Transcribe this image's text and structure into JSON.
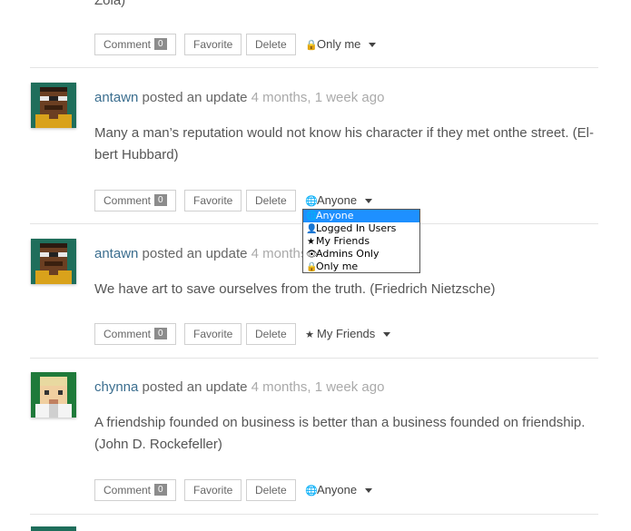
{
  "top_fragment": "Zola)",
  "buttons": {
    "comment": "Comment",
    "favorite": "Favorite",
    "delete": "Delete"
  },
  "verb": "posted an update",
  "top_actions": {
    "comment_count": "0",
    "privacy": "Only me",
    "privacy_icon": "lock-icon"
  },
  "posts": [
    {
      "user": "antawn",
      "time": "4 months, 1 week ago",
      "content": "Many a man’s reputation would not know his character if they met onthe street. (El-bert Hubbard)",
      "comment_count": "0",
      "privacy": "Anyone",
      "privacy_icon": "globe-icon"
    },
    {
      "user": "antawn",
      "time": "4 months",
      "content": "We have art to save ourselves from the truth. (Friedrich Nietzsche)",
      "comment_count": "0",
      "privacy": "My Friends",
      "privacy_icon": "star-icon"
    },
    {
      "user": "chynna",
      "time": "4 months, 1 week ago",
      "content": "A friendship founded on business is better than a business founded on friendship. (John D. Rockefeller)",
      "comment_count": "0",
      "privacy": "Anyone",
      "privacy_icon": "globe-icon"
    }
  ],
  "privacy_dropdown": {
    "options": [
      "Anyone",
      "Logged In Users",
      "My Friends",
      "Admins Only",
      "Only me"
    ],
    "selected": "Anyone",
    "selected_color": "#1e90ff"
  },
  "colors": {
    "link": "#3b6e8f",
    "time": "#aaaaaa",
    "count_badge": "#8c8c8c"
  }
}
